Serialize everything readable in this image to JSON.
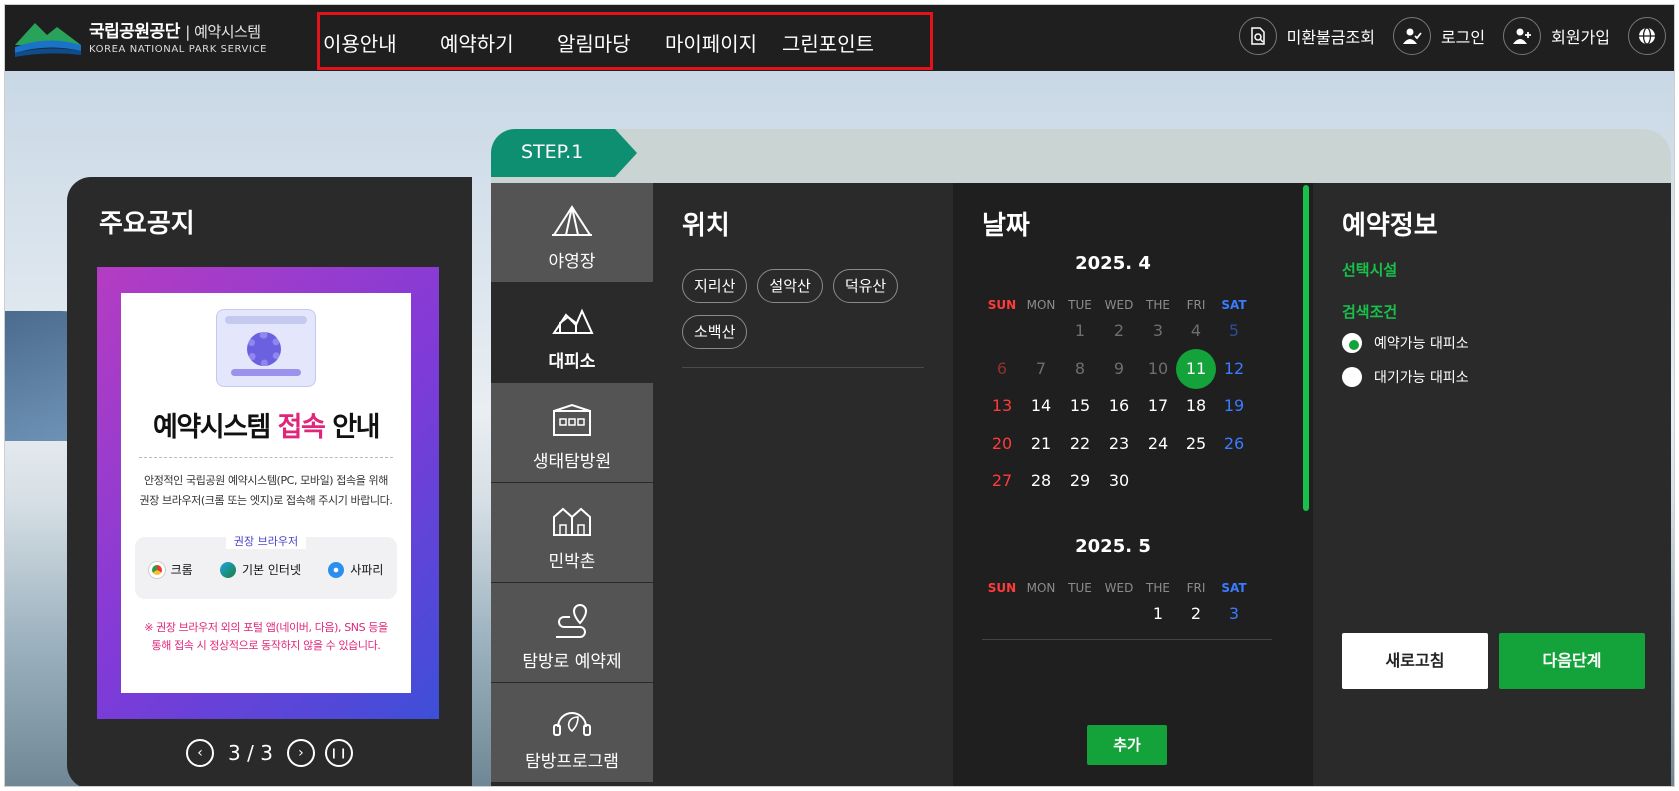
{
  "header": {
    "logo": {
      "org_name": "국립공원공단",
      "system_name": "예약시스템",
      "english_name": "KOREA NATIONAL PARK SERVICE"
    },
    "nav": [
      "이용안내",
      "예약하기",
      "알림마당",
      "마이페이지",
      "그린포인트"
    ],
    "utility": [
      {
        "label": "미환불금조회",
        "icon": "document-search-icon"
      },
      {
        "label": "로그인",
        "icon": "user-check-icon"
      },
      {
        "label": "회원가입",
        "icon": "user-plus-icon"
      }
    ],
    "language_icon": "globe-icon"
  },
  "notice": {
    "title": "주요공지",
    "banner": {
      "headline_part1": "예약시스템",
      "headline_highlight": "접속",
      "headline_part2": "안내",
      "description_line1": "안정적인 국립공원 예약시스템(PC, 모바일) 접속을 위해",
      "description_line2": "권장 브라우저(크롬 또는 엣지)로  접속해 주시기 바랍니다.",
      "browsers_label": "권장 브라우저",
      "browsers": [
        "크롬",
        "기본 인터넷",
        "사파리"
      ],
      "warning_line1": "※ 권장 브라우저 외의 포털 앱(네이버, 다음), SNS 등을",
      "warning_line2": "통해 접속 시 정상적으로 동작하지 않을 수 있습니다."
    },
    "pager": {
      "current": "3",
      "separator": "/",
      "total": "3"
    }
  },
  "step": {
    "label": "STEP.1"
  },
  "categories": [
    {
      "label": "야영장",
      "icon": "tent-icon",
      "active": false
    },
    {
      "label": "대피소",
      "icon": "shelter-icon",
      "active": true
    },
    {
      "label": "생태탐방원",
      "icon": "eco-center-icon",
      "active": false
    },
    {
      "label": "민박촌",
      "icon": "houses-icon",
      "active": false
    },
    {
      "label": "탐방로 예약제",
      "icon": "trail-pin-icon",
      "active": false
    },
    {
      "label": "탐방프로그램",
      "icon": "program-leaf-icon",
      "active": false
    }
  ],
  "location": {
    "title": "위치",
    "options": [
      "지리산",
      "설악산",
      "덕유산",
      "소백산"
    ]
  },
  "calendar": {
    "title": "날짜",
    "weekdays": [
      "SUN",
      "MON",
      "TUE",
      "WED",
      "THE",
      "FRI",
      "SAT"
    ],
    "months": [
      {
        "label": "2025. 4",
        "weeks": [
          [
            "",
            "",
            "1",
            "2",
            "3",
            "4",
            "5"
          ],
          [
            "6",
            "7",
            "8",
            "9",
            "10",
            "11",
            "12"
          ],
          [
            "13",
            "14",
            "15",
            "16",
            "17",
            "18",
            "19"
          ],
          [
            "20",
            "21",
            "22",
            "23",
            "24",
            "25",
            "26"
          ],
          [
            "27",
            "28",
            "29",
            "30",
            "",
            "",
            ""
          ]
        ],
        "past_until": "10",
        "selected": "11"
      },
      {
        "label": "2025. 5",
        "weeks": [
          [
            "",
            "",
            "",
            "",
            "1",
            "2",
            "3"
          ]
        ],
        "past_until": "",
        "selected": ""
      }
    ],
    "add_label": "추가"
  },
  "reservation": {
    "title": "예약정보",
    "selected_facility_label": "선택시설",
    "search_condition_label": "검색조건",
    "options": [
      {
        "label": "예약가능 대피소",
        "checked": true
      },
      {
        "label": "대기가능 대피소",
        "checked": false
      }
    ],
    "refresh_label": "새로고침",
    "next_label": "다음단계"
  },
  "colors": {
    "accent_green": "#14a23a",
    "step_teal": "#0f8f72",
    "highlight_border": "#e3121b",
    "header_bg": "#1f1f1f"
  }
}
